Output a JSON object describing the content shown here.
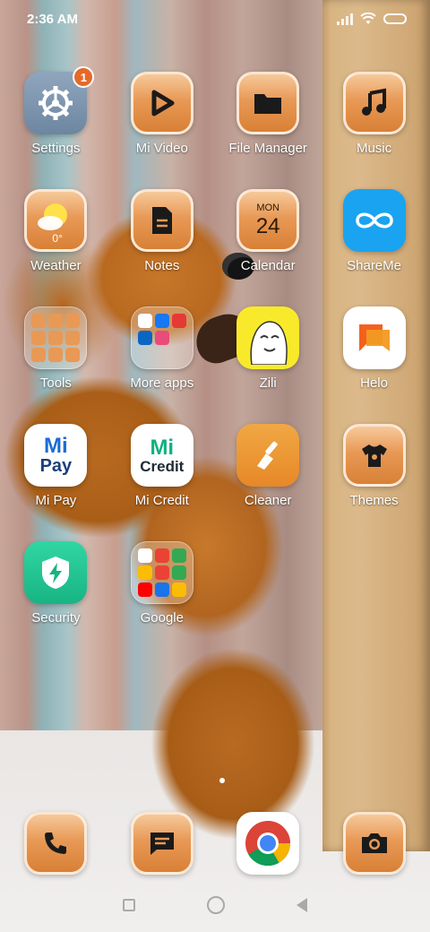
{
  "status_bar": {
    "time": "2:36 AM"
  },
  "badges": {
    "settings": "1"
  },
  "apps": [
    {
      "label": "Settings",
      "icon": "gear-icon"
    },
    {
      "label": "Mi Video",
      "icon": "play-icon"
    },
    {
      "label": "File Manager",
      "icon": "folder-icon"
    },
    {
      "label": "Music",
      "icon": "music-note-icon"
    },
    {
      "label": "Weather",
      "icon": "sun-cloud-icon",
      "temp": "0°"
    },
    {
      "label": "Notes",
      "icon": "note-icon"
    },
    {
      "label": "Calendar",
      "icon": "calendar-icon",
      "month": "MON",
      "day": "24"
    },
    {
      "label": "ShareMe",
      "icon": "infinity-icon"
    },
    {
      "label": "Tools",
      "icon": "folder-tools-icon"
    },
    {
      "label": "More apps",
      "icon": "folder-more-apps-icon"
    },
    {
      "label": "Zili",
      "icon": "zili-face-icon"
    },
    {
      "label": "Helo",
      "icon": "helo-chat-icon"
    },
    {
      "label": "Mi Pay",
      "icon": "mi-pay-icon",
      "logo_top": "Mi",
      "logo_bottom": "Pay"
    },
    {
      "label": "Mi Credit",
      "icon": "mi-credit-icon",
      "logo_top": "Mi",
      "logo_bottom": "Credit"
    },
    {
      "label": "Cleaner",
      "icon": "brush-icon"
    },
    {
      "label": "Themes",
      "icon": "tshirt-icon"
    },
    {
      "label": "Security",
      "icon": "shield-bolt-icon"
    },
    {
      "label": "Google",
      "icon": "folder-google-icon"
    }
  ],
  "dock": [
    {
      "name": "phone",
      "icon": "phone-icon"
    },
    {
      "name": "messages",
      "icon": "message-icon"
    },
    {
      "name": "chrome",
      "icon": "chrome-icon"
    },
    {
      "name": "camera",
      "icon": "camera-icon"
    }
  ],
  "colors": {
    "icon_orange": "#e89956",
    "shareme_blue": "#1aa3f0",
    "security_green": "#18b483",
    "zili_yellow": "#f8ea2a"
  }
}
